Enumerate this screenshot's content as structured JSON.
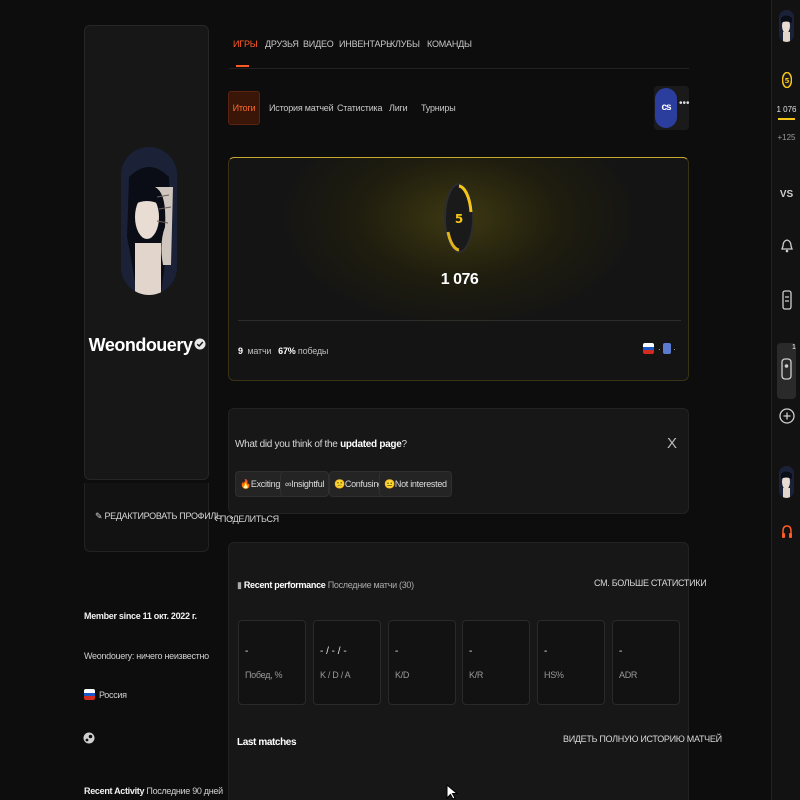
{
  "top_tabs": [
    {
      "label": "ИГРЫ",
      "active": true
    },
    {
      "label": "ДРУЗЬЯ"
    },
    {
      "label": "ВИДЕО"
    },
    {
      "label": "ИНВЕНТАРЬ"
    },
    {
      "label": "КЛУБЫ"
    },
    {
      "label": "КОМАНДЫ"
    }
  ],
  "sub_tabs": [
    {
      "label": "Итоги",
      "active": true
    },
    {
      "label": "История матчей"
    },
    {
      "label": "Статистика"
    },
    {
      "label": "Лиги"
    },
    {
      "label": "Турниры"
    }
  ],
  "game_selector": {
    "logo_text": "cs",
    "more_label": "•••"
  },
  "profile": {
    "username": "Weondouery",
    "edit_label": "РЕДАКТИРОВАТЬ ПРОФИЛЬ",
    "share_label": "ПОДЕЛИТЬСЯ",
    "member_since_label": "Member since",
    "member_since_date": "11 окт. 2022 г.",
    "bio": "Weondouery: ничего неизвестно",
    "country": "Россия",
    "recent_activity_label": "Recent Activity",
    "recent_activity_period": "Последние 90 дней"
  },
  "elo": {
    "level": "5",
    "value": "1 076",
    "matches_count": "9",
    "matches_label": "матчи",
    "winrate": "67%",
    "winrate_label": "победы",
    "level_progress": 0.35,
    "accent": "#f5c518"
  },
  "feedback": {
    "question_prefix": "What did you think of the",
    "question_bold": "updated page",
    "question_suffix": "?",
    "options": [
      {
        "emoji": "🔥",
        "label": "Exciting"
      },
      {
        "emoji": "∞",
        "label": "Insightful"
      },
      {
        "emoji": "😕",
        "label": "Confusing"
      },
      {
        "emoji": "😐",
        "label": "Not interested"
      }
    ],
    "close_label": "X"
  },
  "performance": {
    "title": "Recent performance",
    "subtitle": "Последние матчи (30)",
    "more_label": "СМ. БОЛЬШЕ СТАТИСТИКИ",
    "stats": [
      {
        "value": "-",
        "label": "Побед, %"
      },
      {
        "value": "- / - / -",
        "label": "K / D / A"
      },
      {
        "value": "-",
        "label": "K/D"
      },
      {
        "value": "-",
        "label": "K/R"
      },
      {
        "value": "-",
        "label": "HS%"
      },
      {
        "value": "-",
        "label": "ADR"
      }
    ],
    "last_matches_title": "Last matches",
    "last_matches_more": "ВИДЕТЬ ПОЛНУЮ ИСТОРИЮ МАТЧЕЙ"
  },
  "rail": {
    "elo_value": "1 076",
    "elo_delta": "+125",
    "vs_label": "VS",
    "group_count": "1"
  },
  "colors": {
    "brand": "#ff5a26",
    "elo_gold": "#f5c518",
    "background": "#0d0d0d"
  }
}
